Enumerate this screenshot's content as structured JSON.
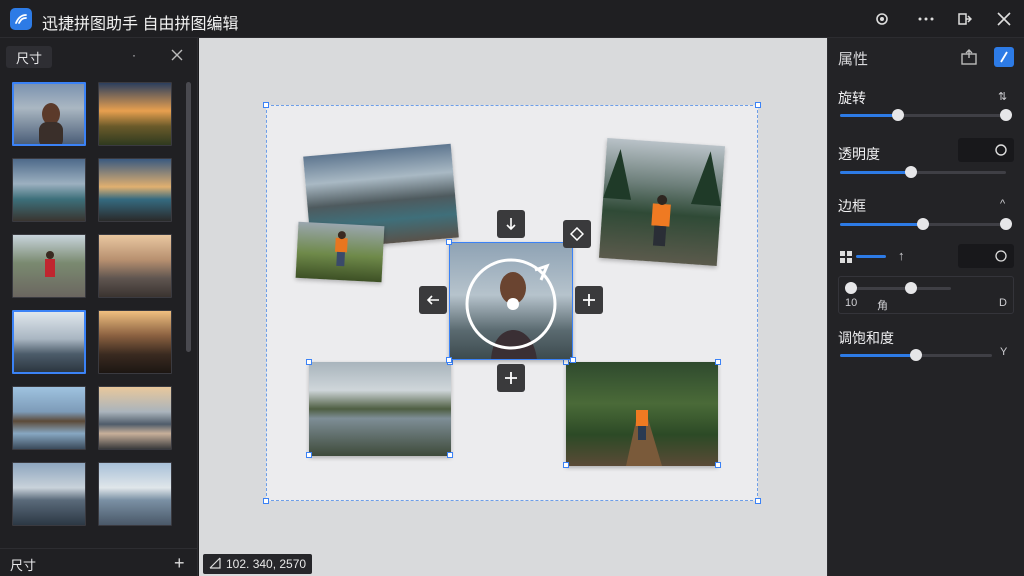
{
  "window": {
    "title": "迅捷拼图助手 自由拼图编辑",
    "icons": [
      "settings-icon",
      "more-icon",
      "export-icon",
      "close-icon"
    ]
  },
  "left_panel": {
    "header_label": "尺寸",
    "sort_label": "·",
    "footer_label": "尺寸",
    "add_label": "+",
    "thumbnails": [
      {
        "subject": "woman-portrait"
      },
      {
        "subject": "sunset-field"
      },
      {
        "subject": "rocky-lake"
      },
      {
        "subject": "dock-sunset"
      },
      {
        "subject": "boy-railway"
      },
      {
        "subject": "empty-road"
      },
      {
        "subject": "reflection-pond"
      },
      {
        "subject": "person-sunset"
      },
      {
        "subject": "lake-house"
      },
      {
        "subject": "mountain-lake"
      },
      {
        "subject": "person-lake"
      },
      {
        "subject": "lake-clouds"
      }
    ]
  },
  "canvas": {
    "coord_readout": "102. 340, 2570",
    "photos": [
      {
        "subject": "rocky-lake"
      },
      {
        "subject": "child-field"
      },
      {
        "subject": "forest-hiker"
      },
      {
        "subject": "woman-portrait"
      },
      {
        "subject": "lake-reflection"
      },
      {
        "subject": "forest-path"
      }
    ]
  },
  "right_panel": {
    "title": "属性",
    "rotate": {
      "label": "旋转",
      "value": 0.35,
      "max_knob": 1.0,
      "icon": "swap-icon"
    },
    "opacity": {
      "label": "透明度",
      "value": 0.43,
      "icon": "circle-icon"
    },
    "border": {
      "label": "边框",
      "value": 0.5,
      "max_knob": 1.0,
      "icon": "chevron-up-icon"
    },
    "row_tools": {
      "layout_icon": "grid-icon",
      "up_icon": "arrow-up-icon",
      "refresh_icon": "refresh-icon"
    },
    "range": {
      "left_label": "10",
      "mid_label": "角",
      "right_label": "D",
      "low": 0.0,
      "high": 0.6
    },
    "saturation": {
      "label": "调饱和度",
      "value": 0.5,
      "icon": "y-icon"
    }
  }
}
